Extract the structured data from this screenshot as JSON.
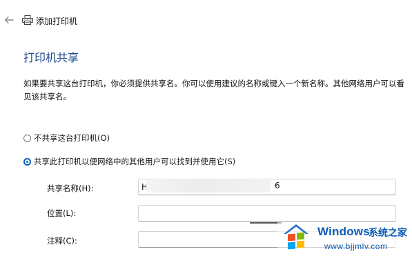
{
  "window": {
    "title": "添加打印机",
    "back_icon": "back-arrow-icon",
    "printer_icon": "printer-icon"
  },
  "page": {
    "heading": "打印机共享",
    "description": "如果要共享这台打印机，你必须提供共享名。你可以使用建议的名称或键入一个新名称。其他网络用户可以看见该共享名。"
  },
  "options": {
    "no_share": {
      "label": "不共享这台打印机(O)",
      "checked": false
    },
    "share": {
      "label": "共享此打印机以便网络中的其他用户可以找到并使用它(S)",
      "checked": true
    }
  },
  "fields": {
    "share_name": {
      "label": "共享名称(H):",
      "value_start": "H",
      "value_end": "6"
    },
    "location": {
      "label": "位置(L):",
      "value": ""
    },
    "comment": {
      "label": "注释(C):",
      "value": ""
    }
  },
  "watermark": {
    "brand": "Windows",
    "brand_cn": "系统之家",
    "url": "www.bjjmlv.com"
  },
  "colors": {
    "heading": "#1c4a8f",
    "accent": "#0b5fbf",
    "watermark": "#0b5bb5"
  }
}
